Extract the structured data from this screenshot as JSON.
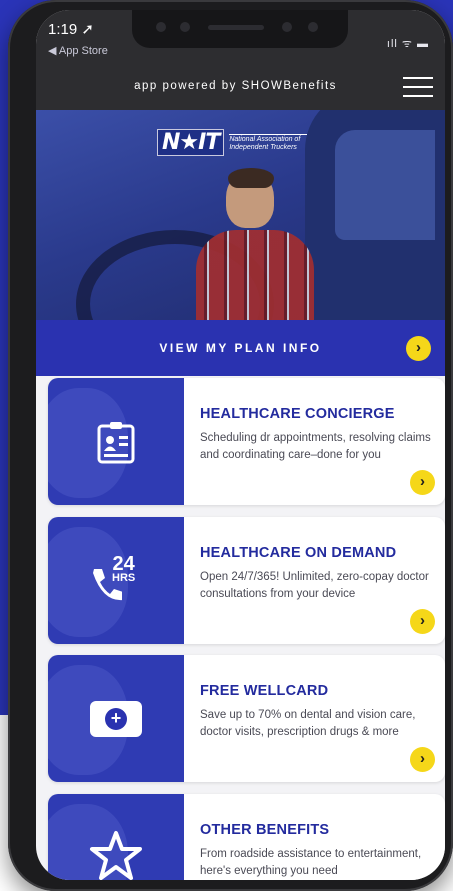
{
  "status_bar": {
    "time": "1:19 ➚",
    "back_app": "◀ App Store",
    "signal": "ıll ᯤ ▬"
  },
  "header": {
    "powered_by": "app powered by SHOWBenefits",
    "menu_icon": "hamburger-menu-icon"
  },
  "hero": {
    "logo_mark": "N★IT",
    "logo_text": "National Association of Independent Truckers"
  },
  "plan_bar": {
    "label": "VIEW MY PLAN INFO",
    "arrow": "›"
  },
  "cards": [
    {
      "title": "HEALTHCARE CONCIERGE",
      "description": "Scheduling dr appointments, resolving claims and coordinating care–done for you",
      "icon": "id-card-icon",
      "arrow": "›"
    },
    {
      "title": "HEALTHCARE ON DEMAND",
      "description": "Open 24/7/365! Unlimited, zero-copay doctor consultations from your device",
      "icon": "phone-24-hours-icon",
      "badge_number": "24",
      "badge_unit": "HRS",
      "arrow": "›"
    },
    {
      "title": "FREE WELLCARD",
      "description": "Save up to 70% on dental and vision care, doctor visits, prescription drugs & more",
      "icon": "medical-card-icon",
      "plus": "+",
      "arrow": "›"
    },
    {
      "title": "OTHER BENEFITS",
      "description": "From roadside assistance to entertainment, here's everything you need",
      "icon": "star-icon",
      "arrow": "›"
    }
  ],
  "colors": {
    "brand_blue": "#2a32b0",
    "title_blue": "#232b9e",
    "accent_yellow": "#f5d719",
    "header_dark": "#2d2d30"
  }
}
